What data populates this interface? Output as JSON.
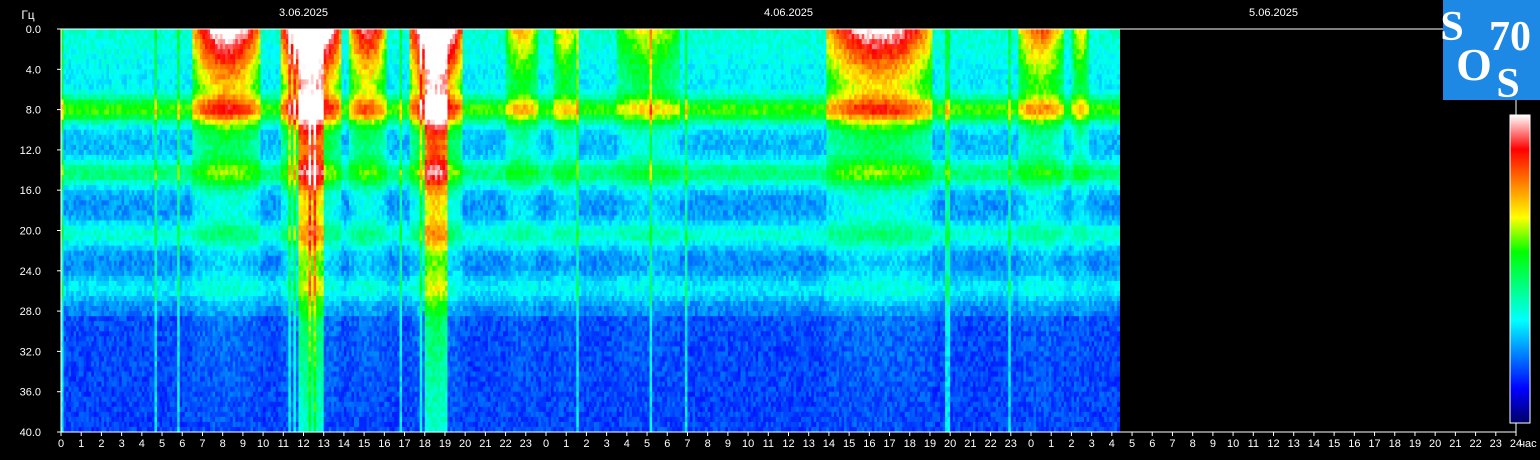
{
  "chart_data": {
    "type": "heatmap",
    "title": "",
    "ylabel": "Гц",
    "xlabel": "час",
    "ylim": [
      0,
      40
    ],
    "y_ticks": [
      "0.0",
      "4.0",
      "8.0",
      "12.0",
      "16.0",
      "20.0",
      "24.0",
      "28.0",
      "32.0",
      "36.0",
      "40.0"
    ],
    "date_labels": [
      {
        "text": "3.06.2025",
        "hour": 12
      },
      {
        "text": "4.06.2025",
        "hour": 36
      },
      {
        "text": "5.06.2025",
        "hour": 60
      }
    ],
    "x_hours": [
      0,
      1,
      2,
      3,
      4,
      5,
      6,
      7,
      8,
      9,
      10,
      11,
      12,
      13,
      14,
      15,
      16,
      17,
      18,
      19,
      20,
      21,
      22,
      23,
      0,
      1,
      2,
      3,
      4,
      5,
      6,
      7,
      8,
      9,
      10,
      11,
      12,
      13,
      14,
      15,
      16,
      17,
      18,
      19,
      20,
      21,
      22,
      23,
      0,
      1,
      2,
      3,
      4,
      5,
      6,
      7,
      8,
      9,
      10,
      11,
      12,
      13,
      14,
      15,
      16,
      17,
      18,
      19,
      20,
      21,
      22,
      23,
      24
    ],
    "data_end_hour": 52.3,
    "resonance_bands_hz": [
      7.8,
      14.1,
      20.2,
      25.5
    ],
    "bursts": [
      {
        "start": 6.5,
        "end": 9.8,
        "intensity": 0.85
      },
      {
        "start": 10.8,
        "end": 13.8,
        "intensity": 1.0
      },
      {
        "start": 14.2,
        "end": 16.0,
        "intensity": 0.7
      },
      {
        "start": 17.2,
        "end": 19.8,
        "intensity": 1.0
      },
      {
        "start": 22.0,
        "end": 23.5,
        "intensity": 0.45
      },
      {
        "start": 24.3,
        "end": 25.5,
        "intensity": 0.4
      },
      {
        "start": 27.5,
        "end": 30.5,
        "intensity": 0.35
      },
      {
        "start": 37.8,
        "end": 43.0,
        "intensity": 0.8
      },
      {
        "start": 47.3,
        "end": 49.5,
        "intensity": 0.55
      },
      {
        "start": 50.0,
        "end": 50.8,
        "intensity": 0.4
      }
    ],
    "colorscale": [
      "#000066",
      "#0000ff",
      "#0080ff",
      "#00ffff",
      "#00ff80",
      "#00ff00",
      "#ffff00",
      "#ff8000",
      "#ff0000",
      "#ffffff"
    ]
  },
  "logo": {
    "letters": [
      "S",
      "70",
      "O",
      "S"
    ]
  }
}
